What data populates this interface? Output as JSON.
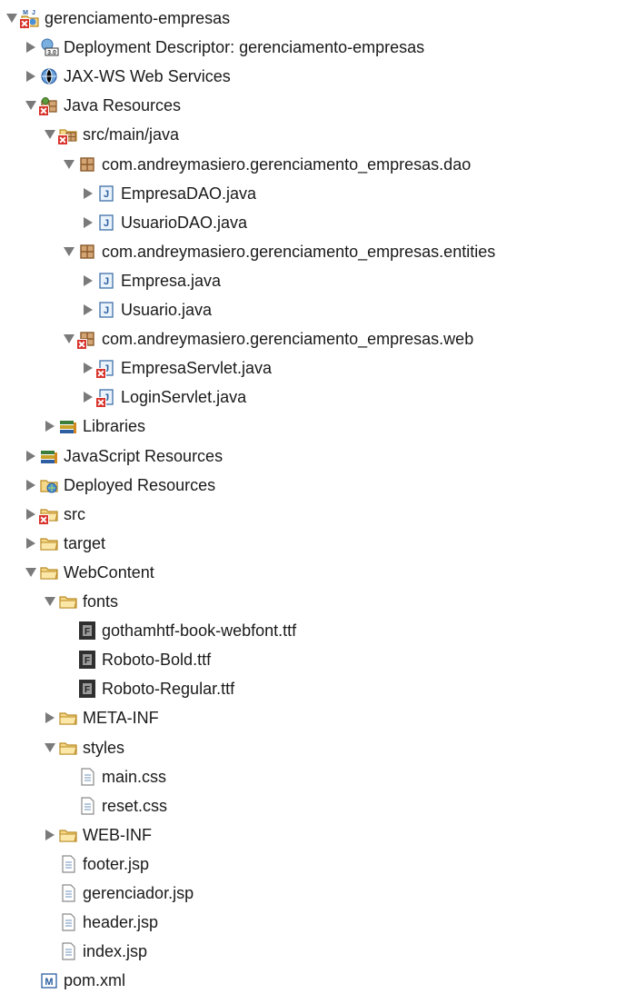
{
  "tree": {
    "items": [
      {
        "label": "gerenciamento-empresas",
        "icon": "maven-web-project-icon",
        "expanded": true,
        "error": true,
        "depth": 0
      },
      {
        "label": "Deployment Descriptor: gerenciamento-empresas",
        "icon": "deployment-descriptor-icon",
        "expanded": false,
        "error": false,
        "depth": 1
      },
      {
        "label": "JAX-WS Web Services",
        "icon": "web-services-icon",
        "expanded": false,
        "error": false,
        "depth": 1
      },
      {
        "label": "Java Resources",
        "icon": "java-resources-icon",
        "expanded": true,
        "error": true,
        "depth": 1
      },
      {
        "label": "src/main/java",
        "icon": "source-folder-icon",
        "expanded": true,
        "error": true,
        "depth": 2
      },
      {
        "label": "com.andreymasiero.gerenciamento_empresas.dao",
        "icon": "package-icon",
        "expanded": true,
        "error": false,
        "depth": 3
      },
      {
        "label": "EmpresaDAO.java",
        "icon": "java-file-icon",
        "expanded": false,
        "error": false,
        "depth": 4
      },
      {
        "label": "UsuarioDAO.java",
        "icon": "java-file-icon",
        "expanded": false,
        "error": false,
        "depth": 4
      },
      {
        "label": "com.andreymasiero.gerenciamento_empresas.entities",
        "icon": "package-icon",
        "expanded": true,
        "error": false,
        "depth": 3
      },
      {
        "label": "Empresa.java",
        "icon": "java-file-icon",
        "expanded": false,
        "error": false,
        "depth": 4
      },
      {
        "label": "Usuario.java",
        "icon": "java-file-icon",
        "expanded": false,
        "error": false,
        "depth": 4
      },
      {
        "label": "com.andreymasiero.gerenciamento_empresas.web",
        "icon": "package-icon",
        "expanded": true,
        "error": true,
        "depth": 3
      },
      {
        "label": "EmpresaServlet.java",
        "icon": "java-file-icon",
        "expanded": false,
        "error": true,
        "depth": 4
      },
      {
        "label": "LoginServlet.java",
        "icon": "java-file-icon",
        "expanded": false,
        "error": true,
        "depth": 4
      },
      {
        "label": "Libraries",
        "icon": "libraries-icon",
        "expanded": false,
        "error": false,
        "depth": 2
      },
      {
        "label": "JavaScript Resources",
        "icon": "libraries-icon",
        "expanded": false,
        "error": false,
        "depth": 1
      },
      {
        "label": "Deployed Resources",
        "icon": "deployed-resources-icon",
        "expanded": false,
        "error": false,
        "depth": 1
      },
      {
        "label": "src",
        "icon": "folder-icon",
        "expanded": false,
        "error": true,
        "depth": 1
      },
      {
        "label": "target",
        "icon": "folder-icon",
        "expanded": false,
        "error": false,
        "depth": 1
      },
      {
        "label": "WebContent",
        "icon": "folder-icon",
        "expanded": true,
        "error": false,
        "depth": 1
      },
      {
        "label": "fonts",
        "icon": "folder-icon",
        "expanded": true,
        "error": false,
        "depth": 2
      },
      {
        "label": "gothamhtf-book-webfont.ttf",
        "icon": "font-file-icon",
        "leaf": true,
        "error": false,
        "depth": 3
      },
      {
        "label": "Roboto-Bold.ttf",
        "icon": "font-file-icon",
        "leaf": true,
        "error": false,
        "depth": 3
      },
      {
        "label": "Roboto-Regular.ttf",
        "icon": "font-file-icon",
        "leaf": true,
        "error": false,
        "depth": 3
      },
      {
        "label": "META-INF",
        "icon": "folder-icon",
        "expanded": false,
        "error": false,
        "depth": 2
      },
      {
        "label": "styles",
        "icon": "folder-icon",
        "expanded": true,
        "error": false,
        "depth": 2
      },
      {
        "label": "main.css",
        "icon": "text-file-icon",
        "leaf": true,
        "error": false,
        "depth": 3
      },
      {
        "label": "reset.css",
        "icon": "text-file-icon",
        "leaf": true,
        "error": false,
        "depth": 3
      },
      {
        "label": "WEB-INF",
        "icon": "folder-icon",
        "expanded": false,
        "error": false,
        "depth": 2
      },
      {
        "label": "footer.jsp",
        "icon": "text-file-icon",
        "leaf": true,
        "error": false,
        "depth": 2
      },
      {
        "label": "gerenciador.jsp",
        "icon": "text-file-icon",
        "leaf": true,
        "error": false,
        "depth": 2
      },
      {
        "label": "header.jsp",
        "icon": "text-file-icon",
        "leaf": true,
        "error": false,
        "depth": 2
      },
      {
        "label": "index.jsp",
        "icon": "text-file-icon",
        "leaf": true,
        "error": false,
        "depth": 2
      },
      {
        "label": "pom.xml",
        "icon": "maven-pom-icon",
        "leaf": true,
        "error": false,
        "depth": 1
      }
    ]
  }
}
